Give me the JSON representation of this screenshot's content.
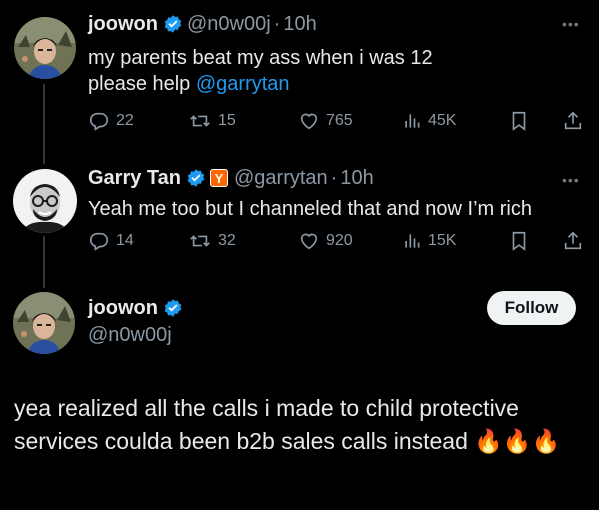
{
  "tweet1": {
    "name": "joowon",
    "handle": "@n0w00j",
    "sep": "·",
    "time": "10h",
    "text_line1": "my parents beat my ass when i was 12",
    "text_line2": "please help ",
    "mention": "@garrytan",
    "more": "•••",
    "replies": "22",
    "retweets": "15",
    "likes": "765",
    "views": "45K"
  },
  "tweet2": {
    "name": "Garry Tan",
    "badge": "Y",
    "handle": "@garrytan",
    "sep": "·",
    "time": "10h",
    "text": "Yeah me too but I channeled that and now I’m rich",
    "more": "•••",
    "replies": "14",
    "retweets": "32",
    "likes": "920",
    "views": "15K"
  },
  "tweet3": {
    "name": "joowon",
    "handle": "@n0w00j",
    "follow_label": "Follow",
    "text": "yea realized all the calls i made to child protective services coulda been b2b sales calls instead 🔥🔥🔥"
  },
  "colors": {
    "background": "#000000",
    "accent": "#1d9bf0",
    "muted": "#8b98a5",
    "text": "#e7e9ea"
  },
  "icons": [
    "verified-icon",
    "reply-icon",
    "retweet-icon",
    "like-icon",
    "views-icon",
    "bookmark-icon",
    "share-icon",
    "more-icon"
  ]
}
